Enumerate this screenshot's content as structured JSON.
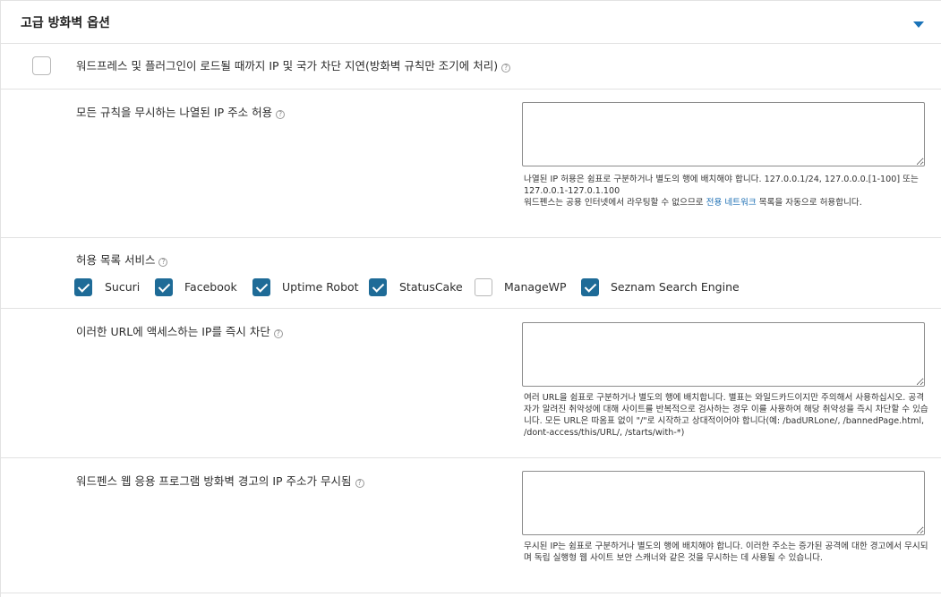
{
  "header": {
    "title": "고급 방화벽 옵션"
  },
  "delay_block": {
    "label": "워드프레스 및 플러그인이 로드될 때까지 IP 및 국가 차단 지연(방화벽 규칙만 조기에 처리)",
    "checked": false
  },
  "allowlist_ips": {
    "label": "모든 규칙을 무시하는 나열된 IP 주소 허용",
    "value": "",
    "hint_line1": "나열된 IP 허용은 쉼표로 구분하거나 별도의 행에 배치해야 합니다. 127.0.0.1/24, 127.0.0.0.[1-100] 또는 127.0.0.1-127.0.1.100",
    "hint_line2_before": "워드펜스는 공용 인터넷에서 라우팅할 수 없으므로 ",
    "hint_link": "전용 네트워크",
    "hint_line2_after": " 목록을 자동으로 허용합니다."
  },
  "services": {
    "label": "허용 목록 서비스",
    "items": [
      {
        "label": "Sucuri",
        "checked": true
      },
      {
        "label": "Facebook",
        "checked": true
      },
      {
        "label": "Uptime Robot",
        "checked": true
      },
      {
        "label": "StatusCake",
        "checked": true
      },
      {
        "label": "ManageWP",
        "checked": false
      },
      {
        "label": "Seznam Search Engine",
        "checked": true
      }
    ]
  },
  "block_urls": {
    "label": "이러한 URL에 액세스하는 IP를 즉시 차단",
    "value": "",
    "hint": "여러 URL을 쉼표로 구분하거나 별도의 행에 배치합니다. 별표는 와일드카드이지만 주의해서 사용하십시오. 공격자가 알려진 취약성에 대해 사이트를 반복적으로 검사하는 경우 이를 사용하여 해당 취약성을 즉시 차단할 수 있습니다. 모든 URL은 따옴표 없이 \"/\"로 시작하고 상대적이어야 합니다(예: /badURLone/, /bannedPage.html, /dont-access/this/URL/, /starts/with-*)"
  },
  "ignore_alerts": {
    "label": "워드펜스 웹 응용 프로그램 방화벽 경고의 IP 주소가 무시됨",
    "value": "",
    "hint": "무시된 IP는 쉼표로 구분하거나 별도의 행에 배치해야 합니다. 이러한 주소는 증가된 공격에 대한 경고에서 무시되며 독립 실행형 웹 사이트 보안 스캐너와 같은 것을 무시하는 데 사용될 수 있습니다."
  },
  "help_glyph": "?"
}
